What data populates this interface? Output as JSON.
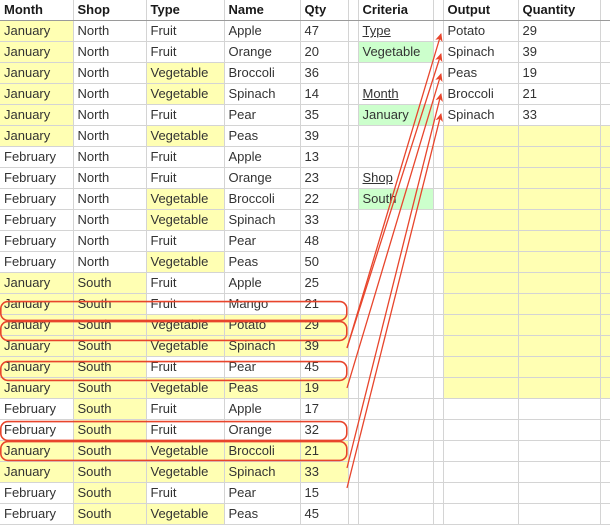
{
  "sheet": {
    "left_table": {
      "columns": [
        "Month",
        "Shop",
        "Type",
        "Name",
        "Qty"
      ],
      "rows": [
        {
          "month": "January",
          "shop": "North",
          "type": "Fruit",
          "name": "Apple",
          "qty": "47",
          "month_hl": true,
          "shop_hl": false,
          "type_hl": false,
          "marked": false
        },
        {
          "month": "January",
          "shop": "North",
          "type": "Fruit",
          "name": "Orange",
          "qty": "20",
          "month_hl": true,
          "shop_hl": false,
          "type_hl": false,
          "marked": false
        },
        {
          "month": "January",
          "shop": "North",
          "type": "Vegetable",
          "name": "Broccoli",
          "qty": "36",
          "month_hl": true,
          "shop_hl": false,
          "type_hl": true,
          "marked": false
        },
        {
          "month": "January",
          "shop": "North",
          "type": "Vegetable",
          "name": "Spinach",
          "qty": "14",
          "month_hl": true,
          "shop_hl": false,
          "type_hl": true,
          "marked": false
        },
        {
          "month": "January",
          "shop": "North",
          "type": "Fruit",
          "name": "Pear",
          "qty": "35",
          "month_hl": true,
          "shop_hl": false,
          "type_hl": false,
          "marked": false
        },
        {
          "month": "January",
          "shop": "North",
          "type": "Vegetable",
          "name": "Peas",
          "qty": "39",
          "month_hl": true,
          "shop_hl": false,
          "type_hl": true,
          "marked": false
        },
        {
          "month": "February",
          "shop": "North",
          "type": "Fruit",
          "name": "Apple",
          "qty": "13",
          "month_hl": false,
          "shop_hl": false,
          "type_hl": false,
          "marked": false
        },
        {
          "month": "February",
          "shop": "North",
          "type": "Fruit",
          "name": "Orange",
          "qty": "23",
          "month_hl": false,
          "shop_hl": false,
          "type_hl": false,
          "marked": false
        },
        {
          "month": "February",
          "shop": "North",
          "type": "Vegetable",
          "name": "Broccoli",
          "qty": "22",
          "month_hl": false,
          "shop_hl": false,
          "type_hl": true,
          "marked": false
        },
        {
          "month": "February",
          "shop": "North",
          "type": "Vegetable",
          "name": "Spinach",
          "qty": "33",
          "month_hl": false,
          "shop_hl": false,
          "type_hl": true,
          "marked": false
        },
        {
          "month": "February",
          "shop": "North",
          "type": "Fruit",
          "name": "Pear",
          "qty": "48",
          "month_hl": false,
          "shop_hl": false,
          "type_hl": false,
          "marked": false
        },
        {
          "month": "February",
          "shop": "North",
          "type": "Vegetable",
          "name": "Peas",
          "qty": "50",
          "month_hl": false,
          "shop_hl": false,
          "type_hl": true,
          "marked": false
        },
        {
          "month": "January",
          "shop": "South",
          "type": "Fruit",
          "name": "Apple",
          "qty": "25",
          "month_hl": true,
          "shop_hl": true,
          "type_hl": false,
          "marked": false
        },
        {
          "month": "January",
          "shop": "South",
          "type": "Fruit",
          "name": "Mango",
          "qty": "21",
          "month_hl": true,
          "shop_hl": true,
          "type_hl": false,
          "marked": false
        },
        {
          "month": "January",
          "shop": "South",
          "type": "Vegetable",
          "name": "Potato",
          "qty": "29",
          "month_hl": true,
          "shop_hl": true,
          "type_hl": true,
          "marked": true
        },
        {
          "month": "January",
          "shop": "South",
          "type": "Vegetable",
          "name": "Spinach",
          "qty": "39",
          "month_hl": true,
          "shop_hl": true,
          "type_hl": true,
          "marked": true
        },
        {
          "month": "January",
          "shop": "South",
          "type": "Fruit",
          "name": "Pear",
          "qty": "45",
          "month_hl": true,
          "shop_hl": true,
          "type_hl": false,
          "marked": false
        },
        {
          "month": "January",
          "shop": "South",
          "type": "Vegetable",
          "name": "Peas",
          "qty": "19",
          "month_hl": true,
          "shop_hl": true,
          "type_hl": true,
          "marked": true
        },
        {
          "month": "February",
          "shop": "South",
          "type": "Fruit",
          "name": "Apple",
          "qty": "17",
          "month_hl": false,
          "shop_hl": true,
          "type_hl": false,
          "marked": false
        },
        {
          "month": "February",
          "shop": "South",
          "type": "Fruit",
          "name": "Orange",
          "qty": "32",
          "month_hl": false,
          "shop_hl": true,
          "type_hl": false,
          "marked": false
        },
        {
          "month": "January",
          "shop": "South",
          "type": "Vegetable",
          "name": "Broccoli",
          "qty": "21",
          "month_hl": true,
          "shop_hl": true,
          "type_hl": true,
          "marked": true
        },
        {
          "month": "January",
          "shop": "South",
          "type": "Vegetable",
          "name": "Spinach",
          "qty": "33",
          "month_hl": true,
          "shop_hl": true,
          "type_hl": true,
          "marked": true
        },
        {
          "month": "February",
          "shop": "South",
          "type": "Fruit",
          "name": "Pear",
          "qty": "15",
          "month_hl": false,
          "shop_hl": true,
          "type_hl": false,
          "marked": false
        },
        {
          "month": "February",
          "shop": "South",
          "type": "Vegetable",
          "name": "Peas",
          "qty": "45",
          "month_hl": false,
          "shop_hl": true,
          "type_hl": true,
          "marked": false
        }
      ]
    },
    "criteria_panel": {
      "header": "Criteria",
      "entries": [
        {
          "label": "Type",
          "value": "Vegetable"
        },
        {
          "label": "Month",
          "value": "January"
        },
        {
          "label": "Shop",
          "value": "South"
        }
      ]
    },
    "output_panel": {
      "headers": [
        "Output",
        "Quantity"
      ],
      "rows": [
        {
          "name": "Potato",
          "qty": "29"
        },
        {
          "name": "Spinach",
          "qty": "39"
        },
        {
          "name": "Peas",
          "qty": "19"
        },
        {
          "name": "Broccoli",
          "qty": "21"
        },
        {
          "name": "Spinach",
          "qty": "33"
        }
      ],
      "empty_rows": 13
    },
    "colors": {
      "highlight_yellow": "#ffffb3",
      "criteria_green": "#ccffcc",
      "arrow_red": "#e8452c",
      "gridline": "#d4d4d4",
      "text": "#333333"
    }
  }
}
